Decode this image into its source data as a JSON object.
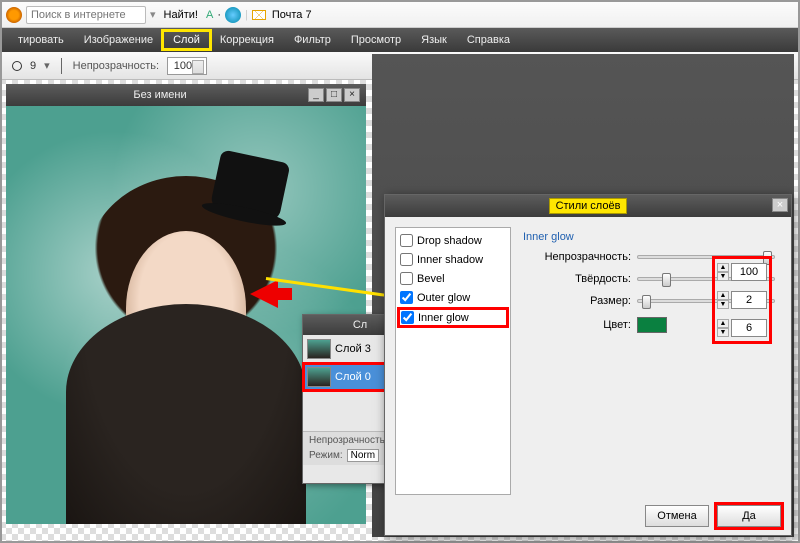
{
  "topbar": {
    "search_placeholder": "Поиск в интернете",
    "find_label": "Найти!",
    "mail_label": "Почта 7"
  },
  "menu": {
    "edit": "тировать",
    "image": "Изображение",
    "layer": "Слой",
    "adjust": "Коррекция",
    "filter": "Фильтр",
    "view": "Просмотр",
    "lang": "Язык",
    "help": "Справка"
  },
  "options": {
    "brush_size": "9",
    "opacity_label": "Непрозрачность:",
    "opacity_value": "100"
  },
  "document": {
    "title": "Без имени"
  },
  "layers_panel": {
    "title": "Сл",
    "layer_top": "Слой 3",
    "layer_sel": "Слой 0",
    "opacity_label": "Непрозрачность:",
    "mode_label": "Режим:",
    "mode_value": "Norm"
  },
  "styles_dialog": {
    "title": "Стили слоёв",
    "list": {
      "drop_shadow": "Drop shadow",
      "inner_shadow": "Inner shadow",
      "bevel": "Bevel",
      "outer_glow": "Outer glow",
      "inner_glow": "Inner glow"
    },
    "params": {
      "section_title": "Inner glow",
      "opacity_label": "Непрозрачность:",
      "opacity_value": "100",
      "hardness_label": "Твёрдость:",
      "hardness_value": "2",
      "size_label": "Размер:",
      "size_value": "6",
      "color_label": "Цвет:"
    },
    "buttons": {
      "cancel": "Отмена",
      "ok": "Да"
    }
  }
}
